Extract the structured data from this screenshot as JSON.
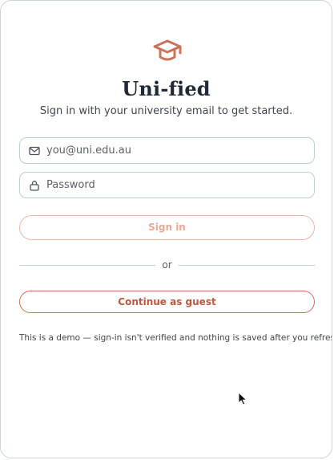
{
  "brand": {
    "title": "Uni-fied",
    "subtitle": "Sign in with your university email to get started.",
    "logo_icon": "graduation-cap-icon",
    "accent_color": "#c9735a"
  },
  "form": {
    "email": {
      "placeholder": "you@uni.edu.au",
      "value": "",
      "icon": "mail-icon"
    },
    "password": {
      "placeholder": "Password",
      "value": "",
      "icon": "lock-icon"
    },
    "signin_label": "Sign in",
    "divider_text": "or",
    "guest_label": "Continue as guest"
  },
  "note": "This is a demo — sign-in isn't verified and nothing is saved after you refresh."
}
